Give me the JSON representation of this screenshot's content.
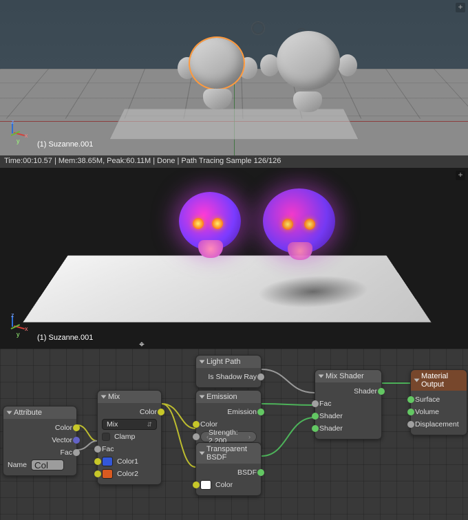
{
  "viewport": {
    "object_label": "(1) Suzanne.001"
  },
  "render": {
    "status": "Time:00:10.57 | Mem:38.65M, Peak:60.11M | Done | Path Tracing Sample 126/126",
    "object_label": "(1) Suzanne.001"
  },
  "nodes": {
    "attribute": {
      "title": "Attribute",
      "out_color": "Color",
      "out_vector": "Vector",
      "out_fac": "Fac",
      "name_label": "Name",
      "name_value": "Col"
    },
    "mix": {
      "title": "Mix",
      "out_color": "Color",
      "blend_mode": "Mix",
      "clamp": "Clamp",
      "in_fac": "Fac",
      "in_color1": "Color1",
      "in_color2": "Color2",
      "color1": "#3357d8",
      "color2": "#d85a21"
    },
    "lightpath": {
      "title": "Light Path",
      "out": "Is Shadow Ray"
    },
    "emission": {
      "title": "Emission",
      "out": "Emission",
      "in_color": "Color",
      "strength_label": "Strength:",
      "strength_value": "2.200"
    },
    "transparent": {
      "title": "Transparent BSDF",
      "out": "BSDF",
      "in_color": "Color",
      "color": "#ffffff"
    },
    "mixshader": {
      "title": "Mix Shader",
      "out": "Shader",
      "in_fac": "Fac",
      "in_shader1": "Shader",
      "in_shader2": "Shader"
    },
    "output": {
      "title": "Material Output",
      "surface": "Surface",
      "volume": "Volume",
      "displacement": "Displacement"
    }
  }
}
